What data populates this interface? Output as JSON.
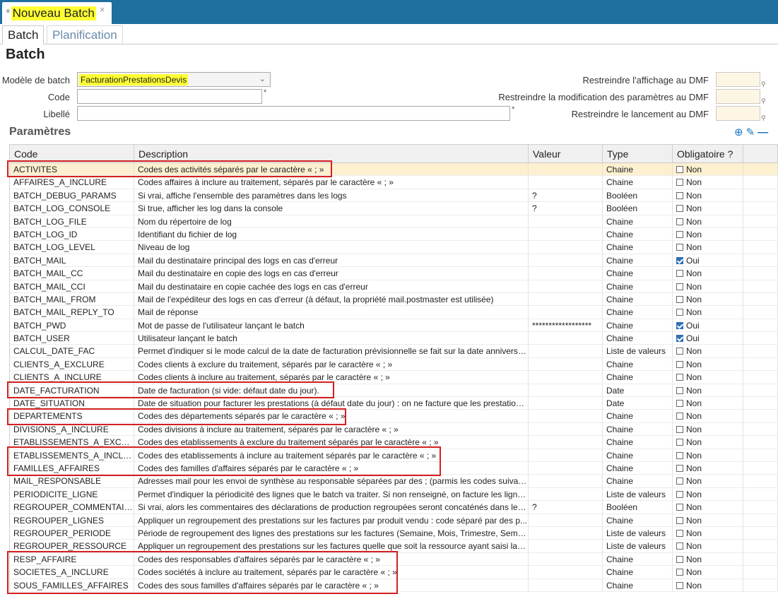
{
  "doc_tab": {
    "modified_mark": "*",
    "title": "Nouveau Batch",
    "close": "×"
  },
  "subtabs": [
    "Batch",
    "Planification"
  ],
  "page_title": "Batch",
  "form": {
    "modele_label": "Modèle de batch",
    "modele_value": "FacturationPrestationsDevis",
    "code_label": "Code",
    "code_value": "",
    "libelle_label": "Libellé",
    "libelle_value": "",
    "required_mark": "*",
    "dmf_affichage_label": "Restreindre l'affichage au DMF",
    "dmf_modification_label": "Restreindre la modification des paramètres au DMF",
    "dmf_lancement_label": "Restreindre le lancement au DMF"
  },
  "params_title": "Paramètres",
  "columns": [
    "Code",
    "Description",
    "Valeur",
    "Type",
    "Obligatoire ?"
  ],
  "rows": [
    {
      "code": "ACTIVITES",
      "desc": "Codes des activités séparés par le caractère « ; »",
      "val": "",
      "type": "Chaine",
      "obl": "Non",
      "checked": false,
      "selected": true
    },
    {
      "code": "AFFAIRES_A_INCLURE",
      "desc": "Codes affaires à inclure au traitement, séparés par le caractère « ; »",
      "val": "",
      "type": "Chaine",
      "obl": "Non",
      "checked": false
    },
    {
      "code": "BATCH_DEBUG_PARAMS",
      "desc": "Si vrai, affiche l'ensemble des paramètres dans les logs",
      "val": "?",
      "type": "Booléen",
      "obl": "Non",
      "checked": false
    },
    {
      "code": "BATCH_LOG_CONSOLE",
      "desc": "Si true, afficher les log dans la console",
      "val": "?",
      "type": "Booléen",
      "obl": "Non",
      "checked": false
    },
    {
      "code": "BATCH_LOG_FILE",
      "desc": "Nom du répertoire de log",
      "val": "",
      "type": "Chaine",
      "obl": "Non",
      "checked": false
    },
    {
      "code": "BATCH_LOG_ID",
      "desc": "Identifiant du fichier de log",
      "val": "",
      "type": "Chaine",
      "obl": "Non",
      "checked": false
    },
    {
      "code": "BATCH_LOG_LEVEL",
      "desc": "Niveau de log",
      "val": "",
      "type": "Chaine",
      "obl": "Non",
      "checked": false
    },
    {
      "code": "BATCH_MAIL",
      "desc": "Mail du destinataire principal des logs en cas d'erreur",
      "val": "",
      "type": "Chaine",
      "obl": "Oui",
      "checked": true
    },
    {
      "code": "BATCH_MAIL_CC",
      "desc": "Mail du destinataire en copie des logs en cas d'erreur",
      "val": "",
      "type": "Chaine",
      "obl": "Non",
      "checked": false
    },
    {
      "code": "BATCH_MAIL_CCI",
      "desc": "Mail du destinataire en copie cachée des logs en cas d'erreur",
      "val": "",
      "type": "Chaine",
      "obl": "Non",
      "checked": false
    },
    {
      "code": "BATCH_MAIL_FROM",
      "desc": "Mail de l'expéditeur des logs en cas d'erreur (à défaut, la propriété mail.postmaster est utilisée)",
      "val": "",
      "type": "Chaine",
      "obl": "Non",
      "checked": false
    },
    {
      "code": "BATCH_MAIL_REPLY_TO",
      "desc": "Mail de réponse",
      "val": "",
      "type": "Chaine",
      "obl": "Non",
      "checked": false
    },
    {
      "code": "BATCH_PWD",
      "desc": "Mot de passe de l'utilisateur lançant le batch",
      "val": "******************",
      "type": "Chaine",
      "obl": "Oui",
      "checked": true
    },
    {
      "code": "BATCH_USER",
      "desc": "Utilisateur lançant le batch",
      "val": "",
      "type": "Chaine",
      "obl": "Oui",
      "checked": true
    },
    {
      "code": "CALCUL_DATE_FAC",
      "desc": "Permet d'indiquer si le mode calcul de la date de facturation prévisionnelle se fait sur la date anniversaire...",
      "val": "",
      "type": "Liste de valeurs",
      "obl": "Non",
      "checked": false
    },
    {
      "code": "CLIENTS_A_EXCLURE",
      "desc": "Codes clients à exclure du traitement, séparés par le caractère « ; »",
      "val": "",
      "type": "Chaine",
      "obl": "Non",
      "checked": false
    },
    {
      "code": "CLIENTS_A_INCLURE",
      "desc": "Codes clients à inclure au traitement, séparés par le caractère « ; »",
      "val": "",
      "type": "Chaine",
      "obl": "Non",
      "checked": false
    },
    {
      "code": "DATE_FACTURATION",
      "desc": "Date de facturation (si vide: défaut date du jour).",
      "val": "",
      "type": "Date",
      "obl": "Non",
      "checked": false
    },
    {
      "code": "DATE_SITUATION",
      "desc": "Date de situation pour facturer les prestations (à défaut date du jour) : on ne facture que les prestations...",
      "val": "",
      "type": "Date",
      "obl": "Non",
      "checked": false
    },
    {
      "code": "DEPARTEMENTS",
      "desc": "Codes des départements séparés par le caractère « ; »",
      "val": "",
      "type": "Chaine",
      "obl": "Non",
      "checked": false
    },
    {
      "code": "DIVISIONS_A_INCLURE",
      "desc": "Codes divisions à inclure au traitement, séparés par le caractère « ; »",
      "val": "",
      "type": "Chaine",
      "obl": "Non",
      "checked": false
    },
    {
      "code": "ETABLISSEMENTS_A_EXCLURE",
      "desc": "Codes des etablissements à exclure du traitement séparés par le caractère « ; »",
      "val": "",
      "type": "Chaine",
      "obl": "Non",
      "checked": false
    },
    {
      "code": "ETABLISSEMENTS_A_INCLURE",
      "desc": "Codes des etablissements à inclure au traitement séparés par le caractère « ; »",
      "val": "",
      "type": "Chaine",
      "obl": "Non",
      "checked": false
    },
    {
      "code": "FAMILLES_AFFAIRES",
      "desc": "Codes des familles d'affaires séparés par le caractère « ; »",
      "val": "",
      "type": "Chaine",
      "obl": "Non",
      "checked": false
    },
    {
      "code": "MAIL_RESPONSABLE",
      "desc": "Adresses mail pour les envoi de synthèse au responsable séparées par des ; (parmis les codes suivants :...",
      "val": "",
      "type": "Chaine",
      "obl": "Non",
      "checked": false
    },
    {
      "code": "PERIODICITE_LIGNE",
      "desc": "Permet d'indiquer la périodicité des lignes que le batch va traiter. Si non renseigné, on facture les lignes...",
      "val": "",
      "type": "Liste de valeurs",
      "obl": "Non",
      "checked": false
    },
    {
      "code": "REGROUPER_COMMENTAIRE",
      "desc": "Si vrai, alors les commentaires des déclarations de production regroupées seront concaténés dans le c...",
      "val": "?",
      "type": "Booléen",
      "obl": "Non",
      "checked": false
    },
    {
      "code": "REGROUPER_LIGNES",
      "desc": "Appliquer un regroupement des prestations sur les factures par produit vendu : code séparé par des p...",
      "val": "",
      "type": "Chaine",
      "obl": "Non",
      "checked": false
    },
    {
      "code": "REGROUPER_PERIODE",
      "desc": "Période de regroupement des lignes des prestations sur les factures (Semaine, Mois, Trimestre, Semestre...",
      "val": "",
      "type": "Liste de valeurs",
      "obl": "Non",
      "checked": false
    },
    {
      "code": "REGROUPER_RESSOURCE",
      "desc": "Appliquer un regroupement des prestations sur les factures quelle que soit la ressource ayant saisi la d...",
      "val": "",
      "type": "Liste de valeurs",
      "obl": "Non",
      "checked": false
    },
    {
      "code": "RESP_AFFAIRE",
      "desc": "Codes des responsables d'affaires séparés par le caractère « ; »",
      "val": "",
      "type": "Chaine",
      "obl": "Non",
      "checked": false
    },
    {
      "code": "SOCIETES_A_INCLURE",
      "desc": "Codes sociétés à inclure au traitement, séparés par le caractère « ; »",
      "val": "",
      "type": "Chaine",
      "obl": "Non",
      "checked": false
    },
    {
      "code": "SOUS_FAMILLES_AFFAIRES",
      "desc": "Codes des sous familles d'affaires séparés par le caractère « ; »",
      "val": "",
      "type": "Chaine",
      "obl": "Non",
      "checked": false
    }
  ],
  "icons": {
    "add": "plus-circle-icon",
    "edit": "pencil-icon",
    "remove": "minus-icon",
    "dmf_pick": "small-dot-icon"
  },
  "colors": {
    "tabbar": "#1f6f9f",
    "highlight": "#ffff33",
    "selected_row": "#fdf0d0",
    "annotation": "#d42020",
    "dmf_field": "#fef6e4"
  }
}
